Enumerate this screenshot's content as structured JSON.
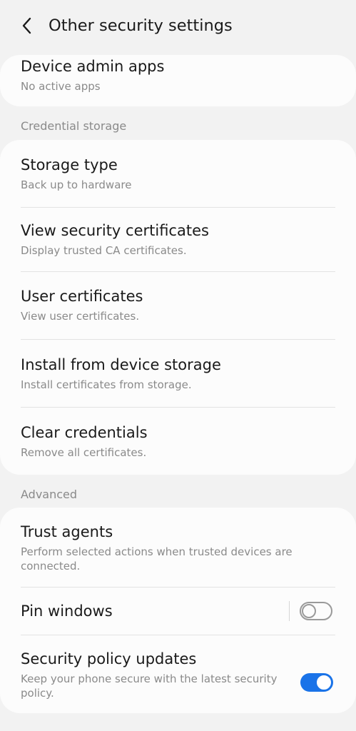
{
  "header": {
    "title": "Other security settings",
    "back_icon": "chevron-left-icon"
  },
  "device_admin": {
    "title": "Device admin apps",
    "subtitle": "No active apps"
  },
  "credential_storage": {
    "section_label": "Credential storage",
    "items": [
      {
        "title": "Storage type",
        "subtitle": "Back up to hardware"
      },
      {
        "title": "View security certificates",
        "subtitle": "Display trusted CA certificates."
      },
      {
        "title": "User certificates",
        "subtitle": "View user certificates."
      },
      {
        "title": "Install from device storage",
        "subtitle": "Install certificates from storage."
      },
      {
        "title": "Clear credentials",
        "subtitle": "Remove all certificates."
      }
    ]
  },
  "advanced": {
    "section_label": "Advanced",
    "trust_agents": {
      "title": "Trust agents",
      "subtitle": "Perform selected actions when trusted devices are connected."
    },
    "pin_windows": {
      "title": "Pin windows",
      "enabled": false
    },
    "security_policy_updates": {
      "title": "Security policy updates",
      "subtitle": "Keep your phone secure with the latest security policy.",
      "enabled": true
    }
  },
  "colors": {
    "accent": "#1a73e8",
    "background": "#f2f2f2",
    "card": "#fcfcfc",
    "secondary_text": "#8a8a8a"
  }
}
